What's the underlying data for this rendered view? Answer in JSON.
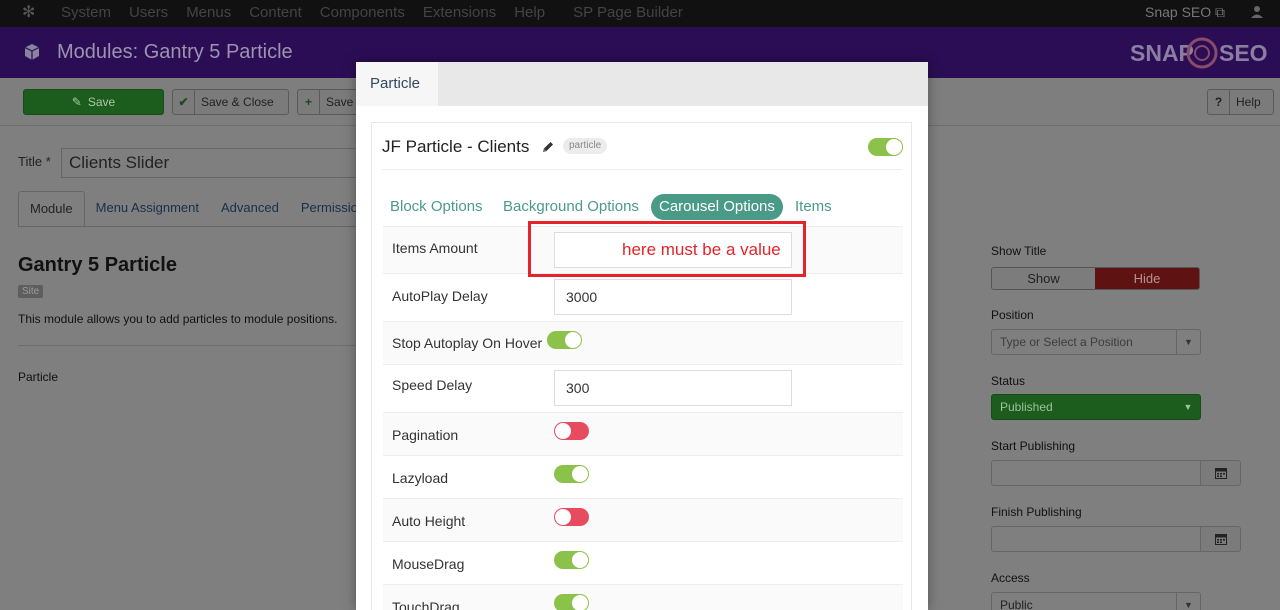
{
  "topbar": {
    "menu": [
      "System",
      "Users",
      "Menus",
      "Content",
      "Components",
      "Extensions",
      "Help",
      "SP Page Builder"
    ],
    "user": "Snap SEO"
  },
  "header": {
    "title": "Modules: Gantry 5 Particle",
    "brand_left": "SNAP",
    "brand_right": "SEO"
  },
  "toolbar": {
    "save": "Save",
    "save_close": "Save & Close",
    "save_new": "Save",
    "help": "Help"
  },
  "form": {
    "title_label": "Title *",
    "title_value": "Clients Slider",
    "tabs": [
      "Module",
      "Menu Assignment",
      "Advanced",
      "Permissio"
    ],
    "module_heading": "Gantry 5 Particle",
    "site_badge": "Site",
    "description": "This module allows you to add particles to module positions.",
    "particle_label": "Particle"
  },
  "right": {
    "show_title_label": "Show Title",
    "show": "Show",
    "hide": "Hide",
    "position_label": "Position",
    "position_placeholder": "Type or Select a Position",
    "status_label": "Status",
    "status_value": "Published",
    "start_label": "Start Publishing",
    "finish_label": "Finish Publishing",
    "access_label": "Access",
    "access_value": "Public"
  },
  "modal": {
    "tab": "Particle",
    "card_title": "JF Particle - Clients",
    "badge": "particle",
    "enabled": true,
    "ptabs": [
      "Block Options",
      "Background Options",
      "Carousel Options",
      "Items"
    ],
    "active_ptab": "Carousel Options",
    "rows": {
      "items_amount": {
        "label": "Items Amount",
        "value": ""
      },
      "autoplay_delay": {
        "label": "AutoPlay Delay",
        "value": "3000"
      },
      "stop_autoplay": {
        "label": "Stop Autoplay On Hover",
        "on": true
      },
      "speed_delay": {
        "label": "Speed Delay",
        "value": "300"
      },
      "pagination": {
        "label": "Pagination",
        "on": false
      },
      "lazyload": {
        "label": "Lazyload",
        "on": true
      },
      "auto_height": {
        "label": "Auto Height",
        "on": false
      },
      "mousedrag": {
        "label": "MouseDrag",
        "on": true
      },
      "touchdrag": {
        "label": "TouchDrag",
        "on": true
      }
    },
    "annotation": "here must be a value",
    "colors": {
      "on": "#8bc34a",
      "off": "#e74c5e",
      "accent": "#4a9a88",
      "annotation": "#e4242a"
    }
  }
}
